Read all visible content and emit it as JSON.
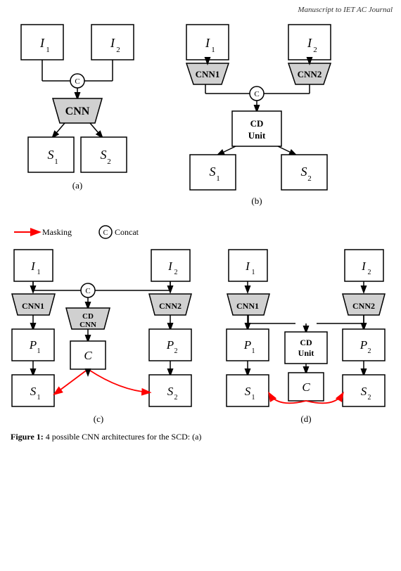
{
  "header": {
    "text": "Manuscript to IET AC Journal"
  },
  "diagrams": {
    "a_label": "(a)",
    "b_label": "(b)",
    "c_label": "(c)",
    "d_label": "(d)"
  },
  "legend": {
    "masking_label": "Masking",
    "concat_label": "Concat"
  },
  "caption": {
    "bold": "Figure 1:",
    "text": " 4 possible CNN architectures for the SCD: (a)"
  }
}
